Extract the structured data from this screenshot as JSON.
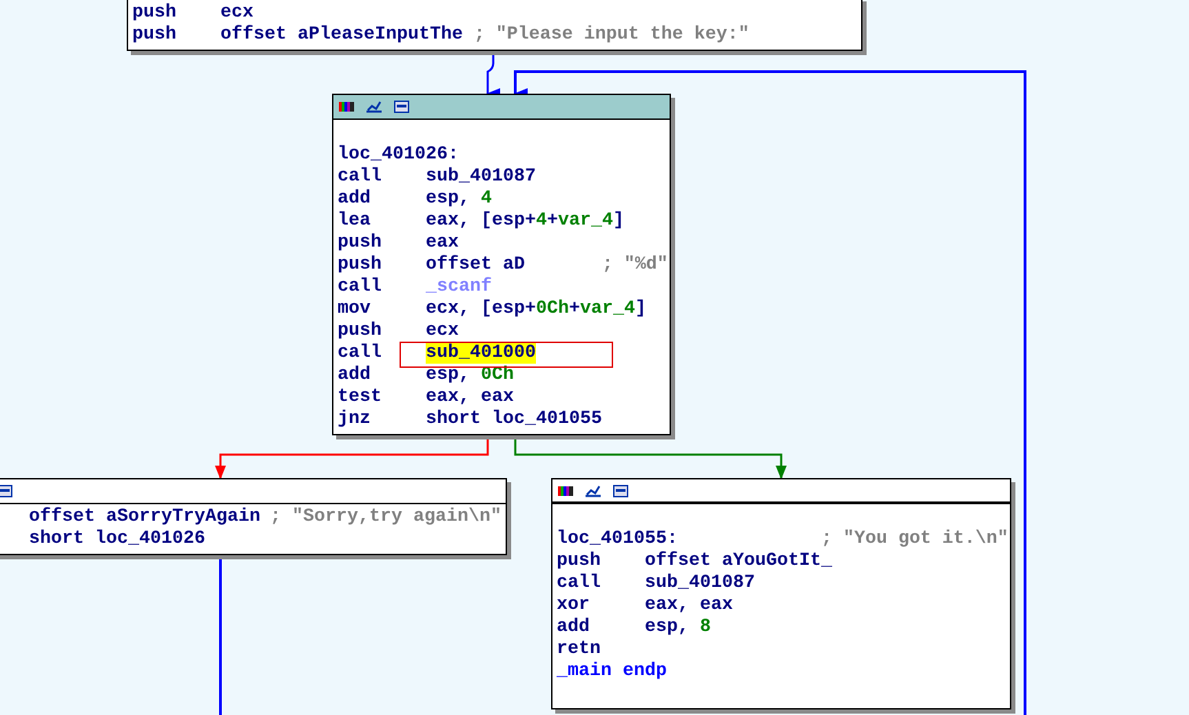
{
  "nodes": [
    {
      "lines": [
        {
          "kind": "instruction",
          "mnemonic": "push",
          "operands": [
            {
              "kind": "code",
              "text": "ecx"
            }
          ]
        },
        {
          "kind": "instruction",
          "mnemonic": "push",
          "operands": [
            {
              "kind": "code",
              "text": "offset aPleaseInputThe"
            }
          ],
          "comment": "; \"Please input the key:\""
        }
      ]
    },
    {
      "selected": true,
      "lines": [
        {
          "kind": "label",
          "label": "loc_401026:"
        },
        {
          "kind": "instruction",
          "mnemonic": "call",
          "operands": [
            {
              "kind": "code",
              "text": "sub_401087"
            }
          ]
        },
        {
          "kind": "instruction",
          "mnemonic": "add",
          "operands": [
            {
              "kind": "code",
              "text": "esp, "
            },
            {
              "kind": "number",
              "text": "4"
            }
          ]
        },
        {
          "kind": "instruction",
          "mnemonic": "lea",
          "operands": [
            {
              "kind": "code",
              "text": "eax, [esp+"
            },
            {
              "kind": "number",
              "text": "4"
            },
            {
              "kind": "code",
              "text": "+"
            },
            {
              "kind": "number",
              "text": "var_4"
            },
            {
              "kind": "code",
              "text": "]"
            }
          ]
        },
        {
          "kind": "instruction",
          "mnemonic": "push",
          "operands": [
            {
              "kind": "code",
              "text": "eax"
            }
          ]
        },
        {
          "kind": "instruction",
          "mnemonic": "push",
          "operands": [
            {
              "kind": "code",
              "text": "offset aD"
            }
          ],
          "comment": "; \"%d\""
        },
        {
          "kind": "instruction",
          "mnemonic": "call",
          "operands": [
            {
              "kind": "import",
              "text": "_scanf"
            }
          ]
        },
        {
          "kind": "instruction",
          "mnemonic": "mov",
          "operands": [
            {
              "kind": "code",
              "text": "ecx, [esp+"
            },
            {
              "kind": "number",
              "text": "0Ch"
            },
            {
              "kind": "code",
              "text": "+"
            },
            {
              "kind": "number",
              "text": "var_4"
            },
            {
              "kind": "code",
              "text": "]"
            }
          ]
        },
        {
          "kind": "instruction",
          "mnemonic": "push",
          "operands": [
            {
              "kind": "code",
              "text": "ecx"
            }
          ]
        },
        {
          "kind": "instruction",
          "mnemonic": "call",
          "operands": [
            {
              "kind": "code",
              "text": "sub_401000",
              "highlighted": true
            }
          ]
        },
        {
          "kind": "instruction",
          "mnemonic": "add",
          "operands": [
            {
              "kind": "code",
              "text": "esp, "
            },
            {
              "kind": "number",
              "text": "0Ch"
            }
          ]
        },
        {
          "kind": "instruction",
          "mnemonic": "test",
          "operands": [
            {
              "kind": "code",
              "text": "eax, eax"
            }
          ]
        },
        {
          "kind": "instruction",
          "mnemonic": "jnz",
          "operands": [
            {
              "kind": "code",
              "text": "short loc_401055"
            }
          ]
        }
      ]
    },
    {
      "selected": false,
      "lines": [
        {
          "kind": "instruction",
          "operands": [
            {
              "kind": "code",
              "text": "offset aSorryTryAgain"
            }
          ],
          "comment": "; \"Sorry,try again\\n\""
        },
        {
          "kind": "instruction",
          "operands": [
            {
              "kind": "code",
              "text": "short loc_401026"
            }
          ]
        }
      ]
    },
    {
      "selected": false,
      "lines": [
        {
          "kind": "label",
          "label": "loc_401055:",
          "comment": "; \"You got it.\\n\""
        },
        {
          "kind": "instruction",
          "mnemonic": "push",
          "operands": [
            {
              "kind": "code",
              "text": "offset aYouGotIt_"
            }
          ]
        },
        {
          "kind": "instruction",
          "mnemonic": "call",
          "operands": [
            {
              "kind": "code",
              "text": "sub_401087"
            }
          ]
        },
        {
          "kind": "instruction",
          "mnemonic": "xor",
          "operands": [
            {
              "kind": "code",
              "text": "eax, eax"
            }
          ]
        },
        {
          "kind": "instruction",
          "mnemonic": "add",
          "operands": [
            {
              "kind": "code",
              "text": "esp, "
            },
            {
              "kind": "number",
              "text": "8"
            }
          ]
        },
        {
          "kind": "instruction",
          "mnemonic": "retn"
        },
        {
          "kind": "directive",
          "label": "_main endp"
        }
      ]
    }
  ]
}
